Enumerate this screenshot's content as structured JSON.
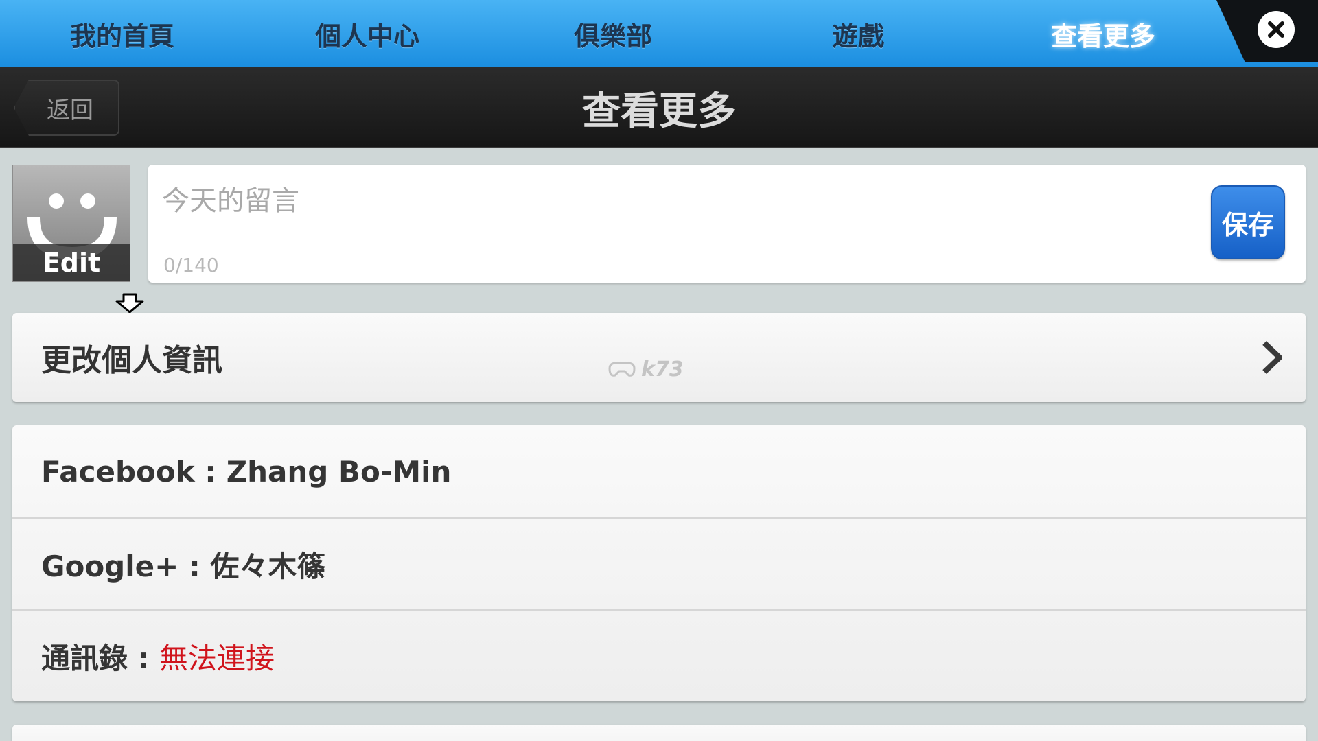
{
  "tabs": [
    {
      "label": "我的首頁",
      "active": false
    },
    {
      "label": "個人中心",
      "active": false
    },
    {
      "label": "俱樂部",
      "active": false
    },
    {
      "label": "遊戲",
      "active": false
    },
    {
      "label": "查看更多",
      "active": true
    }
  ],
  "titlebar": {
    "back_label": "返回",
    "title": "查看更多"
  },
  "profile": {
    "avatar_edit_label": "Edit"
  },
  "message": {
    "placeholder": "今天的留言",
    "value": "",
    "char_count": "0/140",
    "save_label": "保存"
  },
  "menu": {
    "edit_profile_label": "更改個人資訊",
    "watermark": "k73"
  },
  "accounts": {
    "facebook": "Facebook : Zhang Bo-Min",
    "google": "Google+ : 佐々木篠",
    "contacts_label": "通訊錄 : ",
    "contacts_status": "無法連接"
  },
  "colors": {
    "tabbar_top": "#49b3f4",
    "tabbar_bottom": "#1b8ee0",
    "titlebar": "#1f1f1f",
    "save_button": "#2a76dc",
    "error_text": "#d0141c",
    "background": "#cfd7d7"
  }
}
